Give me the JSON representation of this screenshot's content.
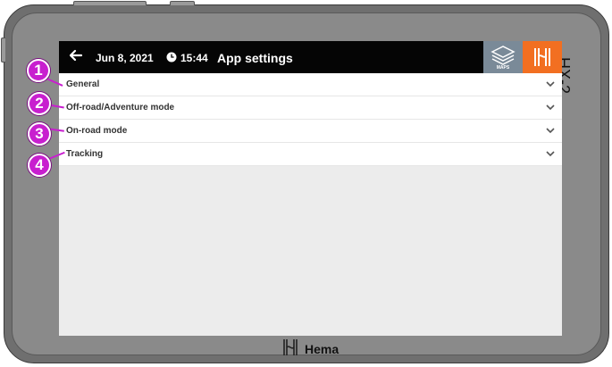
{
  "device": {
    "model": "HX-2",
    "brand": "Hema"
  },
  "topbar": {
    "back_icon": "arrow-left-icon",
    "date": "Jun 8, 2021",
    "clock_icon": "clock-icon",
    "time": "15:44",
    "title": "App settings",
    "maps_label": "MAPS",
    "hema_logo": "hema-logo"
  },
  "settings": {
    "sections": [
      {
        "label": "General"
      },
      {
        "label": "Off-road/Adventure mode"
      },
      {
        "label": "On-road mode"
      },
      {
        "label": "Tracking"
      }
    ]
  },
  "callouts": [
    "1",
    "2",
    "3",
    "4"
  ],
  "colors": {
    "topbar": "#050505",
    "hema_orange": "#f26f21",
    "maps_button": "#7a8a98",
    "callout": "#c81fcf"
  }
}
